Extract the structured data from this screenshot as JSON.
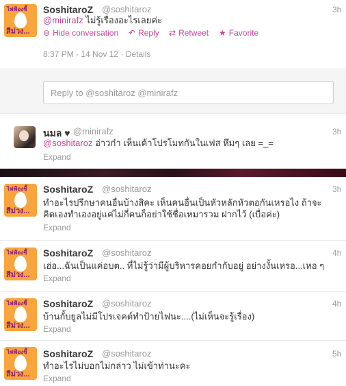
{
  "tweet1": {
    "name": "SoshitaroZ",
    "handle": "@soshitaroz",
    "time": "3h",
    "mention": "@minirafz",
    "text": " ไม่รู้เรื่องอะไรเลยค่ะ",
    "actions": {
      "hide": "Hide conversation",
      "reply": "Reply",
      "retweet": "Retweet",
      "favorite": "Favorite"
    },
    "timestamp": "8:37 PM - 14 Nov 12",
    "details": "Details"
  },
  "reply": {
    "placeholder": "Reply to @soshitaroz @minirafz"
  },
  "tweet2": {
    "name": "นมล ♥",
    "handle": "@minirafz",
    "time": "3h",
    "mention": "@soshitaroz",
    "text": " อ่าวก๋า เห็นเค้าโปรโมทกันในเฟส หึมๆ เลย =_=",
    "expand": "Expand"
  },
  "tweet3": {
    "name": "SoshitaroZ",
    "handle": "@soshitaroz",
    "time": "3h",
    "text_line1": "ทำอะไรปรึกษาคนอื่นบ้างสิคะ เห็นคนอื่นเป็นหัวหลักหัวตอกันเหรอไง ถ้าจะ",
    "text_line2": "คิดเองทำเองอยู่แค่ไม่กี่คนก็อย่าใช้ชื่อเหมารวม ฝากไว้ (เบื่อค่ะ)",
    "expand": "Expand"
  },
  "tweet4": {
    "name": "SoshitaroZ",
    "handle": "@soshitaroz",
    "time": "4h",
    "text": "เฮ่อ...ฉันเป็นแค่อบต.. ที่ไม่รู้ว่ามีผู้บริหารคอยกำกับอยู่ อย่างงั้นเหรอ...เหอ ๆ",
    "expand": "Expand"
  },
  "tweet5": {
    "name": "SoshitaroZ",
    "handle": "@soshitaroz",
    "time": "4h",
    "text": "บ้านกั้บยูลไม่มีโปรเจคต์ทำป้ายไฟนะ....(ไม่เห็นจะรู้เรื่อง)",
    "expand": "Expand"
  },
  "tweet6": {
    "name": "SoshitaroZ",
    "handle": "@soshitaroz",
    "time": "5h",
    "text": "ทำอะไรไม่บอกไม่กล่าว ไม่เข้าท่านะคะ",
    "expand": "Expand"
  },
  "avatar": {
    "top_text": "ไฟฟ้องชี้",
    "bottom_text": "สีม่วง..."
  },
  "colors": {
    "accent": "#c7449b",
    "avatar_bg": "#f7a53c",
    "muted": "#999999"
  }
}
